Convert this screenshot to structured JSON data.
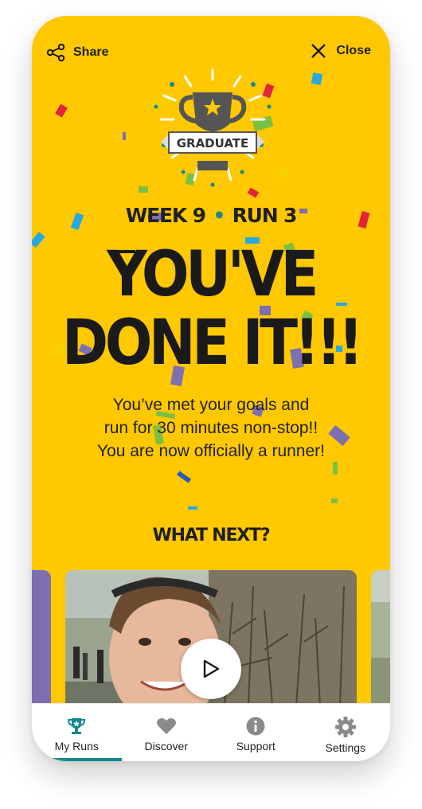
{
  "topbar": {
    "share_label": "Share",
    "close_label": "Close"
  },
  "badge": {
    "text": "GRADUATE"
  },
  "progress": {
    "week": "WEEK 9",
    "separator": "•",
    "run": "RUN 3"
  },
  "headline": {
    "line1": "YOU'VE",
    "line2": "DONE IT!!!"
  },
  "message": {
    "line1": "You’ve met your goals and",
    "line2": "run for 30 minutes non-stop!!",
    "line3": "You are now officially a runner!"
  },
  "what_next": "WHAT NEXT?",
  "tabs": [
    {
      "label": "My Runs",
      "icon": "trophy-icon",
      "active": true
    },
    {
      "label": "Discover",
      "icon": "heart-icon",
      "active": false
    },
    {
      "label": "Support",
      "icon": "info-icon",
      "active": false
    },
    {
      "label": "Settings",
      "icon": "gear-icon",
      "active": false
    }
  ],
  "colors": {
    "background": "#FFC800",
    "accent": "#128A8C",
    "text": "#1A1A1A"
  }
}
